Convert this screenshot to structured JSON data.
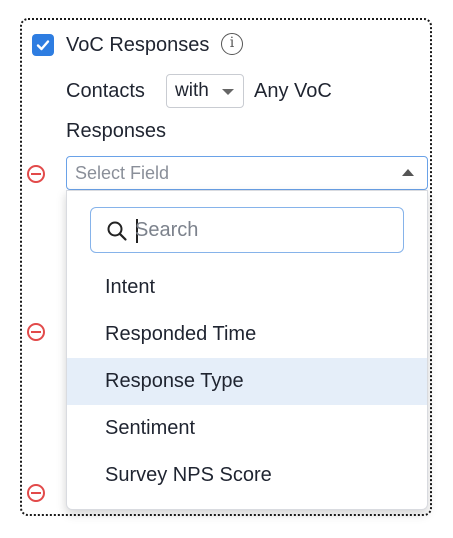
{
  "filter": {
    "checkbox_checked": true,
    "title": "VoC Responses",
    "info_glyph": "i",
    "contacts_label": "Contacts",
    "with_select": {
      "value": "with"
    },
    "any_voc_label": "Any VoC",
    "responses_label": "Responses"
  },
  "field_select": {
    "placeholder": "Select Field",
    "expanded": true
  },
  "dropdown": {
    "search": {
      "placeholder": "Search",
      "value": ""
    },
    "options": [
      {
        "label": "Intent"
      },
      {
        "label": "Responded Time"
      },
      {
        "label": "Response Type",
        "highlighted": true
      },
      {
        "label": "Sentiment"
      },
      {
        "label": "Survey NPS Score"
      }
    ]
  },
  "colors": {
    "accent": "#2e7de1",
    "remove": "#e24a4a",
    "highlight": "#e5eef9",
    "focus_border": "#6aa2e8"
  },
  "icons": [
    "checkmark-icon",
    "info-icon",
    "chevron-down-icon",
    "remove-circle-icon",
    "chevron-up-icon",
    "search-icon"
  ]
}
